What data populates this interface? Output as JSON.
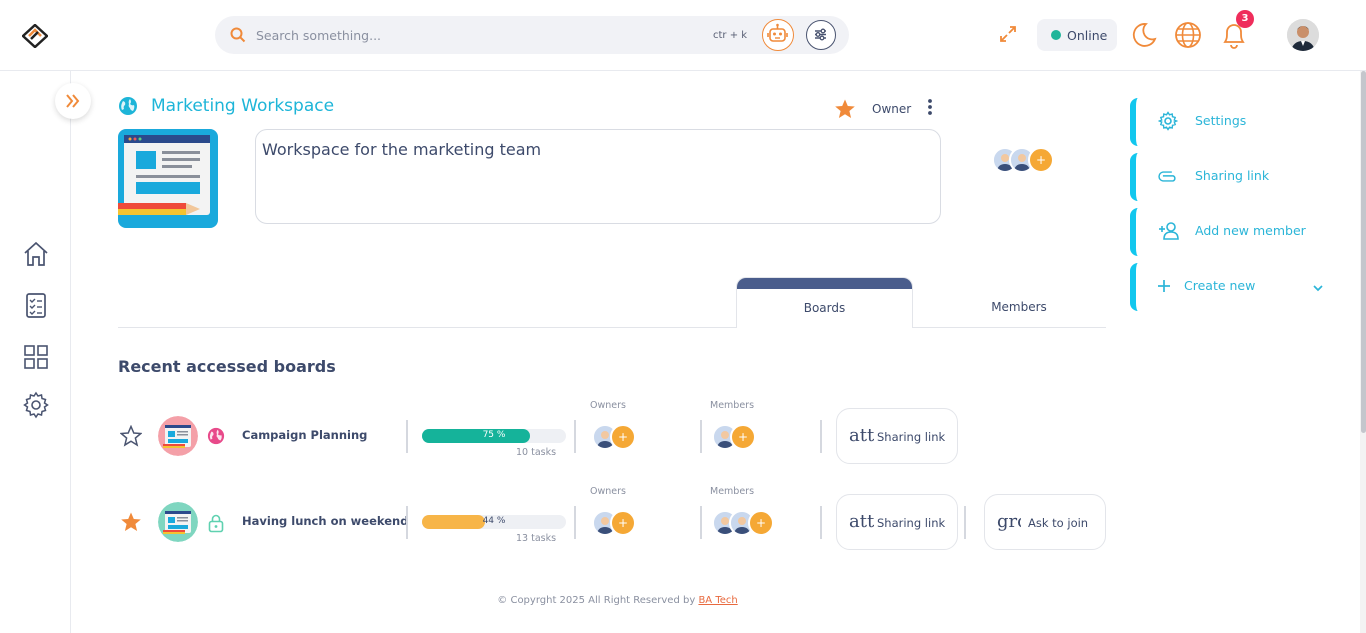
{
  "header": {
    "search_placeholder": "Search something...",
    "shortcut": "ctr + k",
    "status": "Online",
    "notification_count": "3"
  },
  "workspace": {
    "title": "Marketing Workspace",
    "role": "Owner",
    "description": "Workspace for the marketing team"
  },
  "tabs": {
    "boards": "Boards",
    "members": "Members"
  },
  "section_title": "Recent accessed boards",
  "boards": [
    {
      "name": "Campaign Planning",
      "starred": false,
      "visibility": "public",
      "progress": 75,
      "progress_label": "75 %",
      "progress_color": "#15b39a",
      "tasks": "10 tasks",
      "owners_label": "Owners",
      "members_label": "Members",
      "action_glyph": "att",
      "action_label": "Sharing link"
    },
    {
      "name": "Having lunch on weekend",
      "starred": true,
      "visibility": "private",
      "progress": 44,
      "progress_label": "44 %",
      "progress_color": "#f7b548",
      "tasks": "13 tasks",
      "owners_label": "Owners",
      "members_label": "Members",
      "action_glyph": "att",
      "action_label": "Sharing link",
      "action2_glyph": "gro",
      "action2_label": "Ask to join"
    }
  ],
  "right_panel": {
    "settings": "Settings",
    "sharing_link": "Sharing link",
    "add_member": "Add new member",
    "create_new": "Create new"
  },
  "footer": {
    "text": "© Copyrght 2025 All Right Reserved by",
    "brand": "BA Tech"
  },
  "colors": {
    "accent": "#1db5d8",
    "orange": "#f08a3a",
    "navy": "#3d4a6b"
  }
}
